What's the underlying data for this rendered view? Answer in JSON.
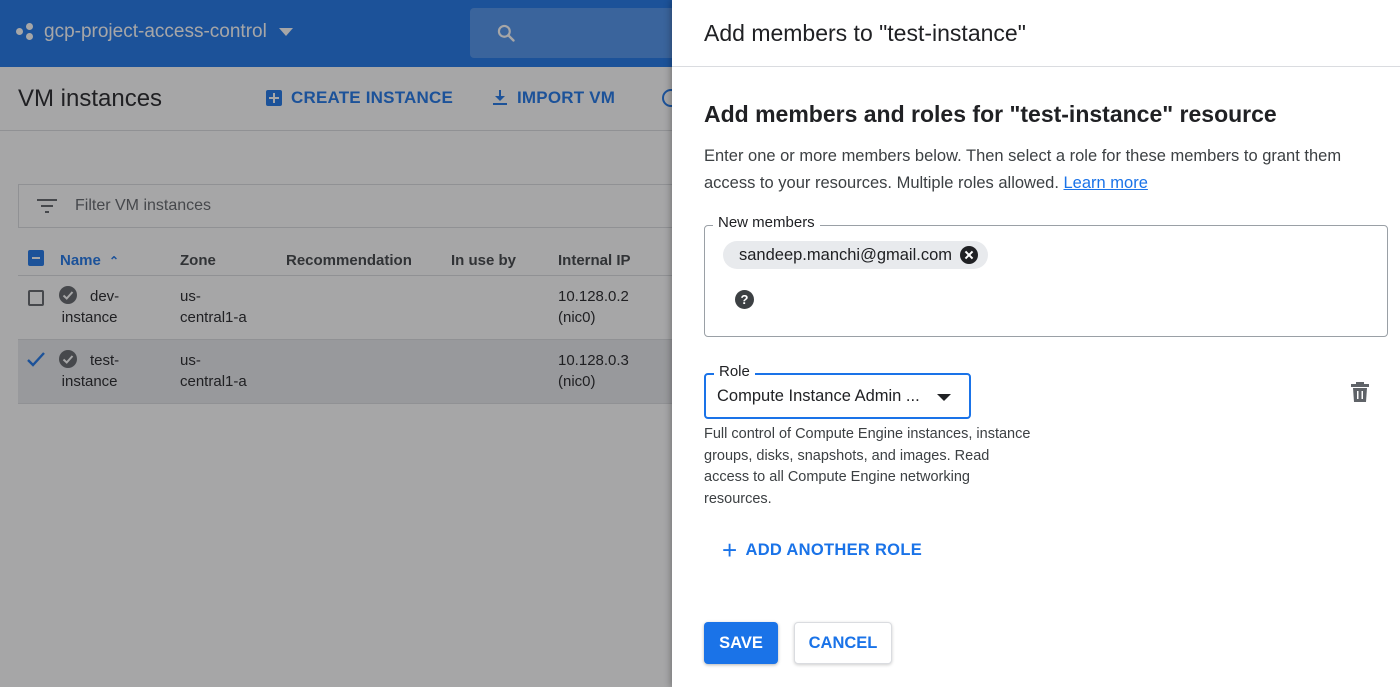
{
  "console": {
    "project_name": "gcp-project-access-control",
    "page_title": "VM instances",
    "actions": {
      "create_instance": "CREATE INSTANCE",
      "import_vm": "IMPORT VM"
    },
    "filter_placeholder": "Filter VM instances",
    "table": {
      "columns": [
        "Name",
        "Zone",
        "Recommendation",
        "In use by",
        "Internal IP"
      ],
      "rows": [
        {
          "name_line1": "dev-",
          "name_line2": "instance",
          "zone_line1": "us-",
          "zone_line2": "central1-a",
          "ip_line1": "10.128.0.2",
          "ip_line2": "(nic0)",
          "selected": false
        },
        {
          "name_line1": "test-",
          "name_line2": "instance",
          "zone_line1": "us-",
          "zone_line2": "central1-a",
          "ip_line1": "10.128.0.3",
          "ip_line2": "(nic0)",
          "selected": true
        }
      ]
    }
  },
  "panel": {
    "title": "Add members to \"test-instance\"",
    "heading": "Add members and roles for \"test-instance\" resource",
    "description": "Enter one or more members below. Then select a role for these members to grant them access to your resources. Multiple roles allowed.",
    "learn_more": "Learn more",
    "members_label": "New members",
    "member_chip": "sandeep.manchi@gmail.com",
    "help_glyph": "?",
    "role_label": "Role",
    "role_value": "Compute Instance Admin ...",
    "role_description": "Full control of Compute Engine instances, instance groups, disks, snapshots, and images. Read access to all Compute Engine networking resources.",
    "add_another_role": "ADD ANOTHER ROLE",
    "add_glyph": "+",
    "save": "SAVE",
    "cancel": "CANCEL"
  },
  "colors": {
    "accent": "#1a73e8",
    "scrim": "rgba(32,33,36,0.4)"
  }
}
